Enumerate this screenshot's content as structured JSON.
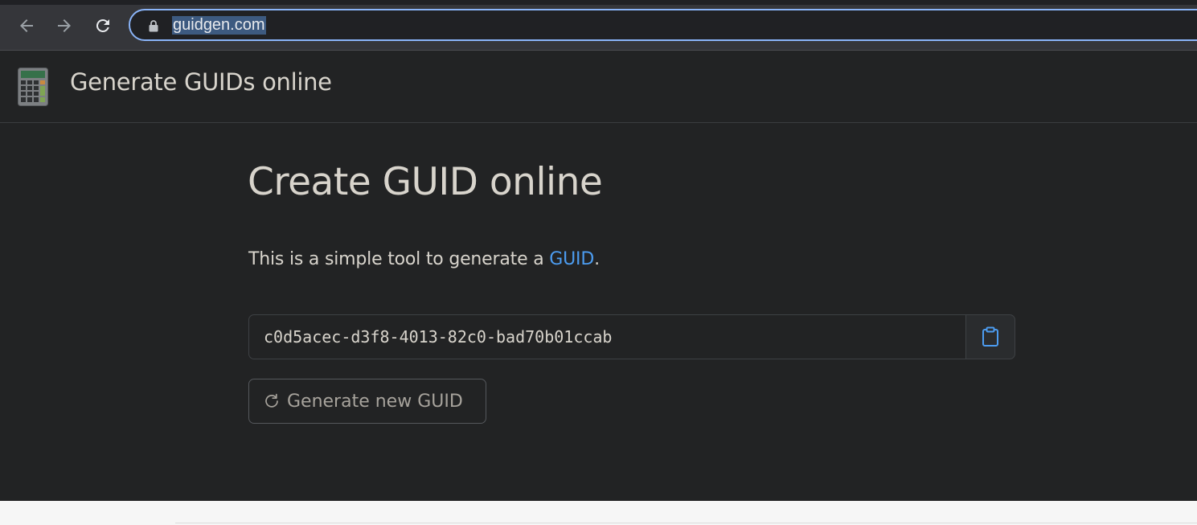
{
  "browser": {
    "url": "guidgen.com",
    "icons": [
      "back-arrow-icon",
      "forward-arrow-icon",
      "reload-icon",
      "lock-icon"
    ],
    "accent_color": "#8ab4f8"
  },
  "site": {
    "title": "Generate GUIDs online",
    "logo_icon": "calculator-icon"
  },
  "main": {
    "heading": "Create GUID online",
    "intro_text": "This is a simple tool to generate a ",
    "intro_link": "GUID",
    "intro_suffix": ".",
    "guid_value": "c0d5acec-d3f8-4013-82c0-bad70b01ccab",
    "copy_icon": "clipboard-icon",
    "generate_button_label": "Generate new GUID",
    "generate_icon": "refresh-icon",
    "link_color": "#4c9cf0",
    "background_color": "#222324"
  }
}
